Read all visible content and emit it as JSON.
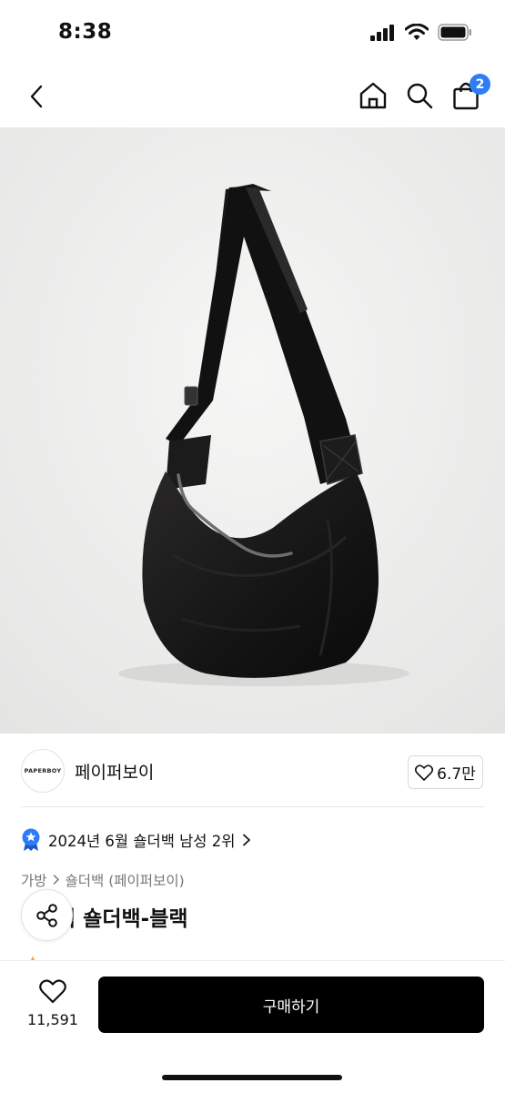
{
  "status_bar": {
    "time": "8:38"
  },
  "nav": {
    "cart_count": "2"
  },
  "brand": {
    "logo_text": "PAPERBOY",
    "name": "페이퍼보이",
    "likes": "6.7만"
  },
  "ranking": {
    "text": "2024년 6월 숄더백 남성 2위"
  },
  "breadcrumb": {
    "category": "가방",
    "subcategory": "숄더백 (페이퍼보이)"
  },
  "product": {
    "title_visible": "픽 숄더백-블랙"
  },
  "bottom_bar": {
    "wish_count": "11,591",
    "buy_label": "구매하기"
  },
  "colors": {
    "accent": "#2e7cf6",
    "button": "#000000",
    "image_bg": "#eeeeee"
  }
}
